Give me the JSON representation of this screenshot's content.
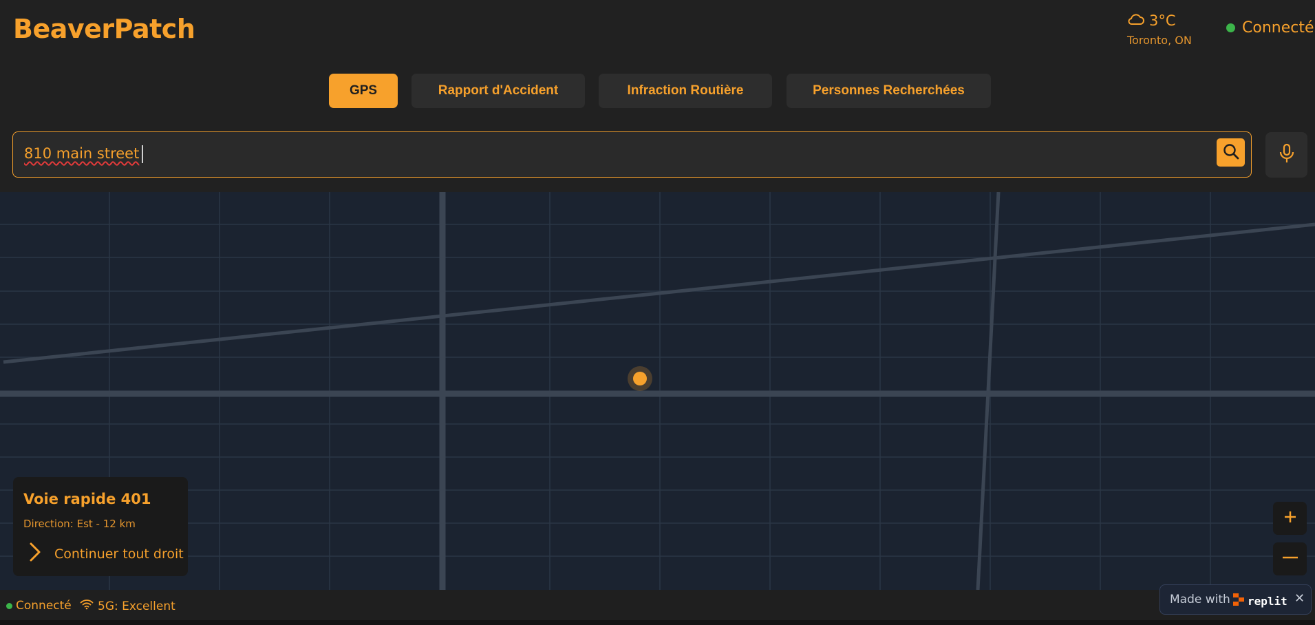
{
  "app": {
    "title": "BeaverPatch"
  },
  "weather": {
    "temperature": "3°C",
    "location": "Toronto, ON",
    "icon": "cloud-icon"
  },
  "connection": {
    "label": "Connecté",
    "color": "#3cb54a"
  },
  "tabs": [
    {
      "label": "GPS",
      "active": true
    },
    {
      "label": "Rapport d'Accident",
      "active": false
    },
    {
      "label": "Infraction Routière",
      "active": false
    },
    {
      "label": "Personnes Recherchées",
      "active": false
    }
  ],
  "search": {
    "value": "810 main street",
    "icon": "search-icon",
    "mic_icon": "microphone-icon"
  },
  "directions": {
    "title": "Voie rapide 401",
    "subtitle": "Direction: Est - 12 km",
    "step": "Continuer tout droit",
    "step_icon": "chevron-right-icon"
  },
  "zoom": {
    "in_icon": "plus-icon",
    "out_icon": "minus-icon"
  },
  "status_bar": {
    "connection": "Connecté",
    "network": "5G: Excellent",
    "network_icon": "wifi-icon"
  },
  "badge": {
    "made_with": "Made with",
    "brand": "replit",
    "close": "✕"
  },
  "colors": {
    "accent": "#f7a12c",
    "background": "#212121",
    "map": "#1b2330",
    "online": "#3cb54a"
  }
}
